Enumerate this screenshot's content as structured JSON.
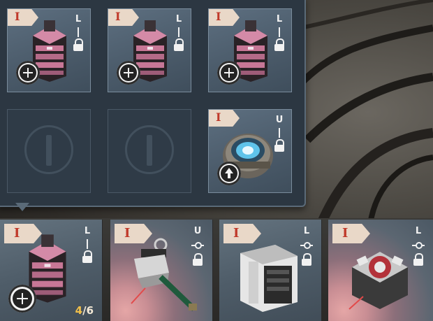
{
  "panel": {
    "slots": [
      {
        "tier": "I",
        "mark": "L",
        "item": "ammo-crate-pink",
        "action": "add",
        "locked": true
      },
      {
        "tier": "I",
        "mark": "L",
        "item": "ammo-crate-pink",
        "action": "add",
        "locked": true
      },
      {
        "tier": "I",
        "mark": "L",
        "item": "ammo-crate-pink",
        "action": "add",
        "locked": true
      },
      {
        "empty": true
      },
      {
        "empty": true
      },
      {
        "tier": "I",
        "mark": "U",
        "item": "energy-core",
        "action": "upgrade",
        "locked": true
      }
    ]
  },
  "bottom_bar": {
    "slots": [
      {
        "tier": "I",
        "mark": "L",
        "item": "ammo-crate-pink",
        "action": "add",
        "locked": true,
        "count_current": "4",
        "count_sep": "/",
        "count_max": "6"
      },
      {
        "tier": "I",
        "mark": "U",
        "item": "turret-weapon",
        "locked": true,
        "highlight": "red"
      },
      {
        "tier": "I",
        "mark": "L",
        "item": "armor-block",
        "locked": true
      },
      {
        "tier": "I",
        "mark": "L",
        "item": "mine-device",
        "locked": true,
        "highlight": "red"
      }
    ]
  },
  "colors": {
    "tier_text": "#c03a2b",
    "tier_badge": "#e9d8c8",
    "count_current": "#f2c04a"
  }
}
